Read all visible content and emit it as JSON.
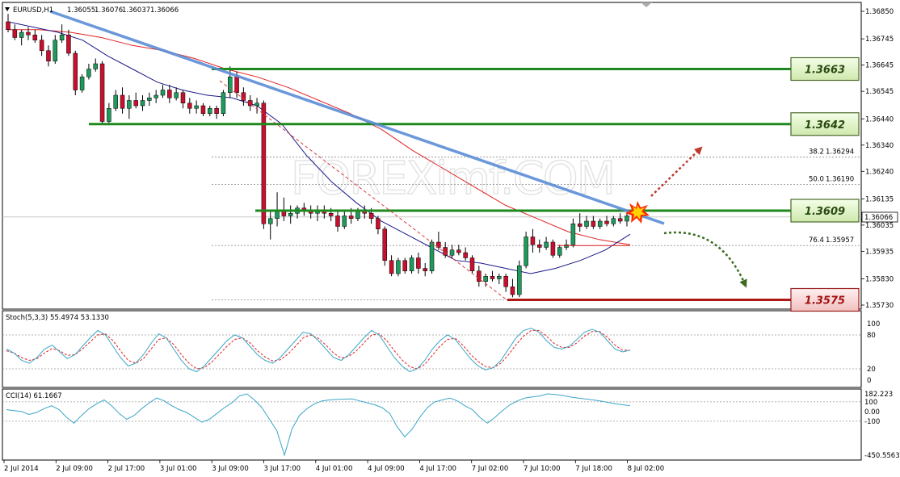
{
  "chart_data": {
    "type": "candlestick",
    "header": {
      "symbol": "EURUSD,H1",
      "open": "1.36055",
      "high": "1.36076",
      "low": "1.36037",
      "close": "1.36066"
    },
    "watermark": "FOREXimf.COM",
    "price_axis": {
      "ticks": [
        "1.36850",
        "1.36745",
        "1.36645",
        "1.36545",
        "1.36440",
        "1.36340",
        "1.36240",
        "1.36135",
        "1.36035",
        "1.35935",
        "1.35830",
        "1.35730"
      ],
      "ylim": [
        1.357,
        1.3687
      ],
      "current_price": "1.36066"
    },
    "time_axis": {
      "labels": [
        "2 Jul 2014",
        "2 Jul 09:00",
        "2 Jul 17:00",
        "3 Jul 01:00",
        "3 Jul 09:00",
        "3 Jul 17:00",
        "4 Jul 01:00",
        "4 Jul 09:00",
        "4 Jul 17:00",
        "7 Jul 02:00",
        "7 Jul 10:00",
        "7 Jul 18:00",
        "8 Jul 02:00"
      ]
    },
    "candles": [
      [
        1.3681,
        1.3684,
        1.3677,
        1.3678
      ],
      [
        1.3678,
        1.368,
        1.3674,
        1.3675
      ],
      [
        1.3675,
        1.3678,
        1.3672,
        1.3677
      ],
      [
        1.3677,
        1.3679,
        1.3674,
        1.3676
      ],
      [
        1.3676,
        1.3678,
        1.3673,
        1.3674
      ],
      [
        1.3674,
        1.3676,
        1.3668,
        1.367
      ],
      [
        1.367,
        1.3672,
        1.3664,
        1.3666
      ],
      [
        1.3666,
        1.3676,
        1.3665,
        1.3674
      ],
      [
        1.3674,
        1.368,
        1.3673,
        1.3676
      ],
      [
        1.3676,
        1.3678,
        1.3668,
        1.3669
      ],
      [
        1.3669,
        1.367,
        1.3653,
        1.3655
      ],
      [
        1.3655,
        1.3661,
        1.3654,
        1.366
      ],
      [
        1.366,
        1.3665,
        1.3659,
        1.3663
      ],
      [
        1.3663,
        1.3667,
        1.3662,
        1.3665
      ],
      [
        1.3665,
        1.3666,
        1.3642,
        1.3643
      ],
      [
        1.3643,
        1.365,
        1.3642,
        1.3648
      ],
      [
        1.3648,
        1.3655,
        1.3647,
        1.3653
      ],
      [
        1.3653,
        1.3656,
        1.3646,
        1.3648
      ],
      [
        1.3648,
        1.3653,
        1.3644,
        1.3651
      ],
      [
        1.3651,
        1.3654,
        1.3648,
        1.3649
      ],
      [
        1.3649,
        1.3653,
        1.3647,
        1.3651
      ],
      [
        1.3651,
        1.3654,
        1.3649,
        1.3652
      ],
      [
        1.3652,
        1.3655,
        1.365,
        1.3653
      ],
      [
        1.3653,
        1.3657,
        1.3652,
        1.3655
      ],
      [
        1.3655,
        1.3657,
        1.365,
        1.3652
      ],
      [
        1.3652,
        1.3656,
        1.3651,
        1.3654
      ],
      [
        1.3654,
        1.3655,
        1.3648,
        1.365
      ],
      [
        1.365,
        1.3652,
        1.3646,
        1.3648
      ],
      [
        1.3648,
        1.3651,
        1.3646,
        1.3649
      ],
      [
        1.3649,
        1.365,
        1.3645,
        1.3646
      ],
      [
        1.3646,
        1.3649,
        1.3645,
        1.3648
      ],
      [
        1.3648,
        1.3649,
        1.3644,
        1.3646
      ],
      [
        1.3646,
        1.3655,
        1.3645,
        1.3654
      ],
      [
        1.3654,
        1.3664,
        1.3652,
        1.366
      ],
      [
        1.366,
        1.3662,
        1.3652,
        1.3654
      ],
      [
        1.3654,
        1.3656,
        1.3649,
        1.3651
      ],
      [
        1.3651,
        1.3653,
        1.3647,
        1.3649
      ],
      [
        1.3649,
        1.3652,
        1.3646,
        1.365
      ],
      [
        1.365,
        1.3651,
        1.3602,
        1.3604
      ],
      [
        1.3604,
        1.3609,
        1.3598,
        1.3606
      ],
      [
        1.3606,
        1.3616,
        1.3603,
        1.3609
      ],
      [
        1.3609,
        1.3614,
        1.3605,
        1.3607
      ],
      [
        1.3607,
        1.3611,
        1.3604,
        1.3608
      ],
      [
        1.3608,
        1.3611,
        1.3606,
        1.361
      ],
      [
        1.361,
        1.3612,
        1.3607,
        1.3609
      ],
      [
        1.3609,
        1.3611,
        1.3606,
        1.3608
      ],
      [
        1.3608,
        1.3611,
        1.3605,
        1.3609
      ],
      [
        1.3609,
        1.3611,
        1.3606,
        1.3608
      ],
      [
        1.3608,
        1.361,
        1.3605,
        1.3607
      ],
      [
        1.3607,
        1.3609,
        1.3601,
        1.3603
      ],
      [
        1.3603,
        1.3609,
        1.3602,
        1.3607
      ],
      [
        1.3607,
        1.361,
        1.3604,
        1.3606
      ],
      [
        1.3606,
        1.361,
        1.3605,
        1.3609
      ],
      [
        1.3609,
        1.3611,
        1.3606,
        1.3608
      ],
      [
        1.3608,
        1.361,
        1.3604,
        1.3606
      ],
      [
        1.3606,
        1.3607,
        1.36,
        1.3602
      ],
      [
        1.3602,
        1.3603,
        1.3588,
        1.359
      ],
      [
        1.359,
        1.3592,
        1.3584,
        1.3585
      ],
      [
        1.3585,
        1.3591,
        1.3584,
        1.359
      ],
      [
        1.359,
        1.3591,
        1.3585,
        1.3586
      ],
      [
        1.3586,
        1.3592,
        1.3585,
        1.3591
      ],
      [
        1.3591,
        1.3593,
        1.3585,
        1.3587
      ],
      [
        1.3587,
        1.3589,
        1.3584,
        1.3586
      ],
      [
        1.3586,
        1.3598,
        1.3585,
        1.3597
      ],
      [
        1.3597,
        1.3601,
        1.3594,
        1.3595
      ],
      [
        1.3595,
        1.3597,
        1.3591,
        1.3592
      ],
      [
        1.3592,
        1.3596,
        1.3591,
        1.3594
      ],
      [
        1.3594,
        1.3596,
        1.3592,
        1.3593
      ],
      [
        1.3593,
        1.3595,
        1.359,
        1.3591
      ],
      [
        1.3591,
        1.3592,
        1.3585,
        1.3586
      ],
      [
        1.3586,
        1.3588,
        1.358,
        1.3582
      ],
      [
        1.3582,
        1.3585,
        1.358,
        1.3584
      ],
      [
        1.3584,
        1.3586,
        1.3582,
        1.3583
      ],
      [
        1.3583,
        1.3585,
        1.3581,
        1.3584
      ],
      [
        1.3584,
        1.3585,
        1.3578,
        1.358
      ],
      [
        1.358,
        1.3583,
        1.3576,
        1.3577
      ],
      [
        1.3577,
        1.359,
        1.3576,
        1.3588
      ],
      [
        1.3588,
        1.3601,
        1.3587,
        1.3599
      ],
      [
        1.3599,
        1.3602,
        1.3593,
        1.3596
      ],
      [
        1.3596,
        1.3598,
        1.3593,
        1.3595
      ],
      [
        1.3595,
        1.3599,
        1.3594,
        1.3597
      ],
      [
        1.3597,
        1.3598,
        1.3591,
        1.3592
      ],
      [
        1.3592,
        1.3596,
        1.3591,
        1.3595
      ],
      [
        1.3595,
        1.3598,
        1.3594,
        1.3596
      ],
      [
        1.3596,
        1.3606,
        1.3595,
        1.3604
      ],
      [
        1.3604,
        1.3608,
        1.3601,
        1.3603
      ],
      [
        1.3603,
        1.3607,
        1.3602,
        1.3605
      ],
      [
        1.3605,
        1.3607,
        1.3602,
        1.3603
      ],
      [
        1.3603,
        1.3606,
        1.3602,
        1.3605
      ],
      [
        1.3605,
        1.3607,
        1.3603,
        1.3604
      ],
      [
        1.3604,
        1.3607,
        1.3603,
        1.3606
      ],
      [
        1.3606,
        1.3608,
        1.3604,
        1.3605
      ],
      [
        1.3605,
        1.3608,
        1.3603,
        1.3607
      ]
    ],
    "ma_fast": [
      1.3681,
      1.3679,
      1.3677,
      1.3674,
      1.3668,
      1.3663,
      1.3658,
      1.3655,
      1.3653,
      1.3652,
      1.3649,
      1.3642,
      1.363,
      1.362,
      1.3612,
      1.3605,
      1.36,
      1.3595,
      1.359,
      1.3589,
      1.3587,
      1.3585,
      1.3587,
      1.359,
      1.3594,
      1.36
    ],
    "ma_slow": [
      1.3678,
      1.3678,
      1.3677,
      1.3675,
      1.3672,
      1.367,
      1.3667,
      1.3663,
      1.366,
      1.3656,
      1.3651,
      1.3646,
      1.364,
      1.3632,
      1.3625,
      1.3618,
      1.3611,
      1.3606,
      1.3601,
      1.3598,
      1.3596
    ],
    "levels": [
      {
        "value": "1.3663",
        "kind": "resistance"
      },
      {
        "value": "1.3642",
        "kind": "resistance"
      },
      {
        "value": "1.3609",
        "kind": "pivot"
      },
      {
        "value": "1.3575",
        "kind": "support"
      }
    ],
    "fib_levels": [
      {
        "ratio": "38.2",
        "price": "1.36294"
      },
      {
        "ratio": "50.0",
        "price": "1.36190"
      },
      {
        "ratio": "76.4",
        "price": "1.35957"
      }
    ],
    "stoch": {
      "label": "Stoch(5,3,3) 55.4974 53.1330",
      "ticks": [
        "100",
        "80",
        "20",
        "0"
      ],
      "main": [
        55,
        48,
        35,
        30,
        40,
        55,
        62,
        50,
        38,
        45,
        60,
        75,
        88,
        80,
        60,
        40,
        25,
        30,
        45,
        65,
        82,
        75,
        55,
        35,
        20,
        15,
        25,
        40,
        55,
        70,
        80,
        75,
        60,
        45,
        35,
        30,
        40,
        55,
        70,
        85,
        82,
        70,
        55,
        40,
        35,
        45,
        60,
        75,
        88,
        80,
        60,
        40,
        25,
        15,
        20,
        35,
        55,
        70,
        80,
        72,
        55,
        38,
        25,
        18,
        22,
        35,
        55,
        75,
        88,
        92,
        85,
        70,
        58,
        55,
        60,
        72,
        85,
        90,
        85,
        70,
        55,
        50,
        53
      ],
      "signal": [
        52,
        48,
        40,
        35,
        38,
        48,
        56,
        52,
        44,
        45,
        55,
        68,
        80,
        82,
        70,
        52,
        35,
        30,
        38,
        55,
        72,
        75,
        63,
        45,
        30,
        20,
        22,
        32,
        46,
        60,
        72,
        75,
        66,
        52,
        41,
        34,
        36,
        46,
        60,
        75,
        80,
        74,
        62,
        48,
        39,
        42,
        52,
        66,
        80,
        82,
        70,
        52,
        36,
        24,
        20,
        28,
        44,
        60,
        72,
        74,
        62,
        46,
        33,
        24,
        22,
        30,
        45,
        63,
        78,
        88,
        88,
        78,
        65,
        58,
        58,
        66,
        78,
        86,
        86,
        76,
        62,
        53,
        53
      ]
    },
    "cci": {
      "label": "CCI(14) 61.1667",
      "ticks": [
        "182.223",
        "100",
        "0.00",
        "-100",
        "-450.5563"
      ],
      "values": [
        20,
        10,
        0,
        -30,
        -10,
        30,
        60,
        20,
        -60,
        -120,
        -40,
        30,
        80,
        120,
        60,
        -20,
        -80,
        -40,
        30,
        90,
        140,
        110,
        60,
        20,
        -10,
        -60,
        -110,
        -80,
        -20,
        40,
        90,
        160,
        182,
        120,
        40,
        -80,
        -200,
        -450,
        -180,
        -40,
        30,
        80,
        110,
        120,
        125,
        128,
        130,
        110,
        90,
        70,
        40,
        -20,
        -160,
        -260,
        -180,
        -60,
        40,
        100,
        120,
        140,
        110,
        60,
        20,
        -60,
        -120,
        -60,
        10,
        70,
        110,
        140,
        150,
        160,
        182,
        175,
        165,
        150,
        140,
        130,
        120,
        110,
        95,
        80,
        70,
        61
      ],
      "ylim": [
        -450,
        182
      ]
    }
  },
  "annotations": {
    "arrow_up_color": "#c0392b",
    "arrow_down_color": "#3a6b1f",
    "trendline_color": "#5b8dd6",
    "resistance_color": "#1e8a1e",
    "support_color": "#c01a1a"
  }
}
